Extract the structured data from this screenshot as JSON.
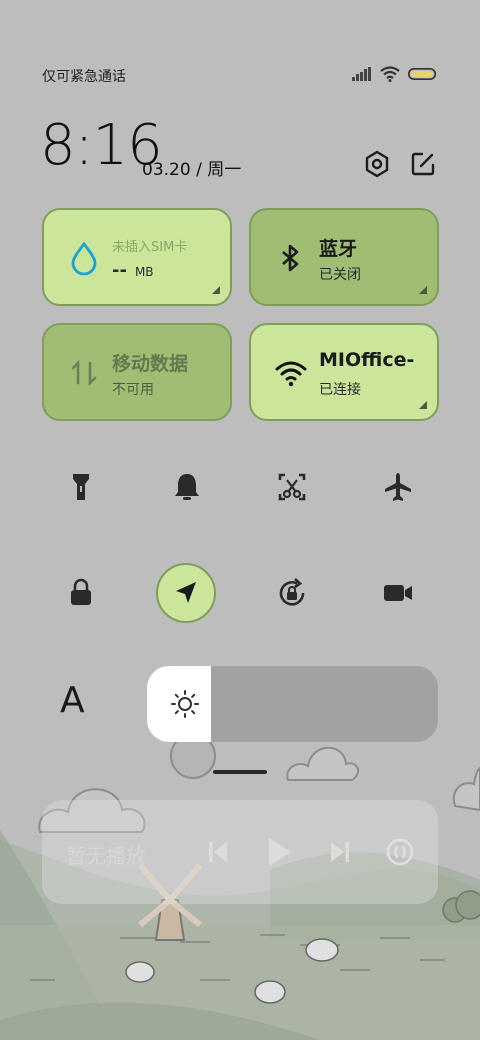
{
  "status": {
    "carrier_text": "仅可紧急通话",
    "icons": [
      "signal-icon",
      "wifi-icon",
      "battery-icon"
    ]
  },
  "header": {
    "time": "8:16",
    "date": "03.20 / 周一"
  },
  "tiles": {
    "data": {
      "label": "未插入SIM卡",
      "value": "--",
      "unit": "MB",
      "state": "on",
      "icon": "water-drop-icon"
    },
    "bluetooth": {
      "label": "蓝牙",
      "status": "已关闭",
      "state": "off",
      "icon": "bluetooth-icon"
    },
    "mobile_data": {
      "label": "移动数据",
      "status": "不可用",
      "state": "off",
      "icon": "mobile-data-icon"
    },
    "wifi": {
      "label": "MIOffice-",
      "status": "已连接",
      "state": "on",
      "icon": "wifi-icon"
    }
  },
  "toggles": {
    "row1": [
      {
        "name": "flashlight",
        "icon": "flashlight-icon",
        "on": false
      },
      {
        "name": "silent",
        "icon": "bell-icon",
        "on": false
      },
      {
        "name": "screenshot",
        "icon": "screenshot-icon",
        "on": false
      },
      {
        "name": "airplane",
        "icon": "airplane-icon",
        "on": false
      }
    ],
    "row2": [
      {
        "name": "lock",
        "icon": "lock-icon",
        "on": false
      },
      {
        "name": "location",
        "icon": "location-icon",
        "on": true
      },
      {
        "name": "rotation-lock",
        "icon": "rotation-lock-icon",
        "on": false
      },
      {
        "name": "screen-record",
        "icon": "video-camera-icon",
        "on": false
      }
    ]
  },
  "brightness": {
    "font_button": "A",
    "level": 0.22
  },
  "media": {
    "label": "暂无播放",
    "controls": [
      "previous-icon",
      "play-icon",
      "next-icon",
      "cast-icon"
    ]
  },
  "colors": {
    "tile_on": "#cbe69a",
    "tile_off": "#9fbd73",
    "background": "#bdbdbd"
  }
}
